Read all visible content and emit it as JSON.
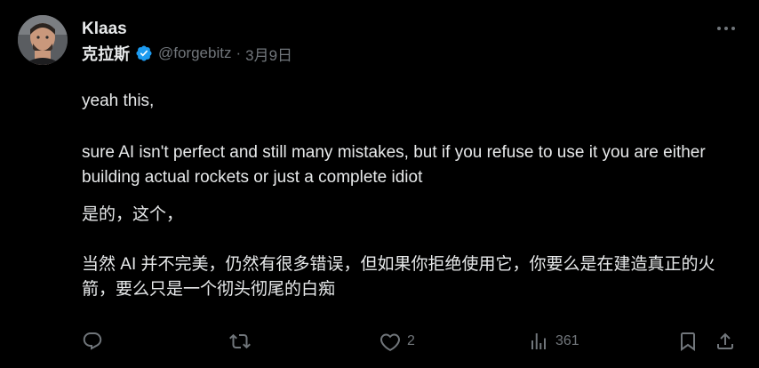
{
  "tweet": {
    "display_name": "Klaas",
    "display_name_cn": "克拉斯",
    "handle": "@forgebitz",
    "separator": "·",
    "date": "3月9日",
    "text": {
      "line1": "yeah this,",
      "paragraph2": "sure AI isn't perfect and still many mistakes, but if you refuse to use it you are either building actual rockets or just a complete idiot",
      "translation_line1": "是的，这个，",
      "translation_paragraph2": "当然 AI 并不完美，仍然有很多错误，但如果你拒绝使用它，你要么是在建造真正的火箭，要么只是一个彻头彻尾的白痴"
    },
    "actions": {
      "reply_count": "",
      "retweet_count": "",
      "like_count": "2",
      "view_count": "361"
    }
  },
  "colors": {
    "background": "#000000",
    "text": "#e7e9ea",
    "muted": "#71767b",
    "verified": "#1d9bf0"
  },
  "icons": [
    "avatar",
    "verified-badge-icon",
    "more-icon",
    "reply-icon",
    "retweet-icon",
    "like-icon",
    "views-icon",
    "bookmark-icon",
    "share-icon"
  ]
}
